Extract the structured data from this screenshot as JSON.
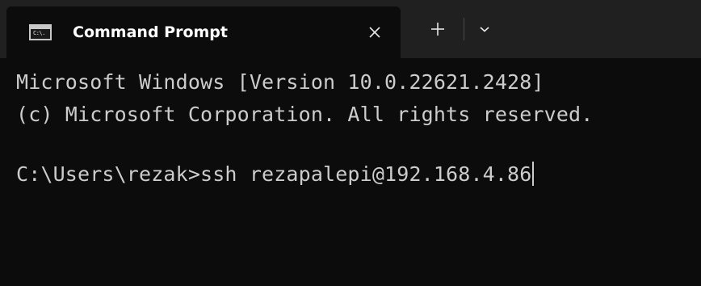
{
  "tab": {
    "title": "Command Prompt",
    "icon": "cmd-icon",
    "icon_text": "C:\\."
  },
  "toolbar": {
    "close_icon": "close-icon",
    "new_tab_icon": "plus-icon",
    "dropdown_icon": "chevron-down-icon"
  },
  "terminal": {
    "lines": [
      "Microsoft Windows [Version 10.0.22621.2428]",
      "(c) Microsoft Corporation. All rights reserved.",
      "C:\\Users\\rezak>ssh rezapalepi@192.168.4.86"
    ]
  },
  "colors": {
    "titlebar": "#202020",
    "tab_active": "#0c0c0c",
    "terminal_bg": "#0c0c0c",
    "terminal_text": "#cccccc",
    "tab_text": "#ffffff"
  }
}
